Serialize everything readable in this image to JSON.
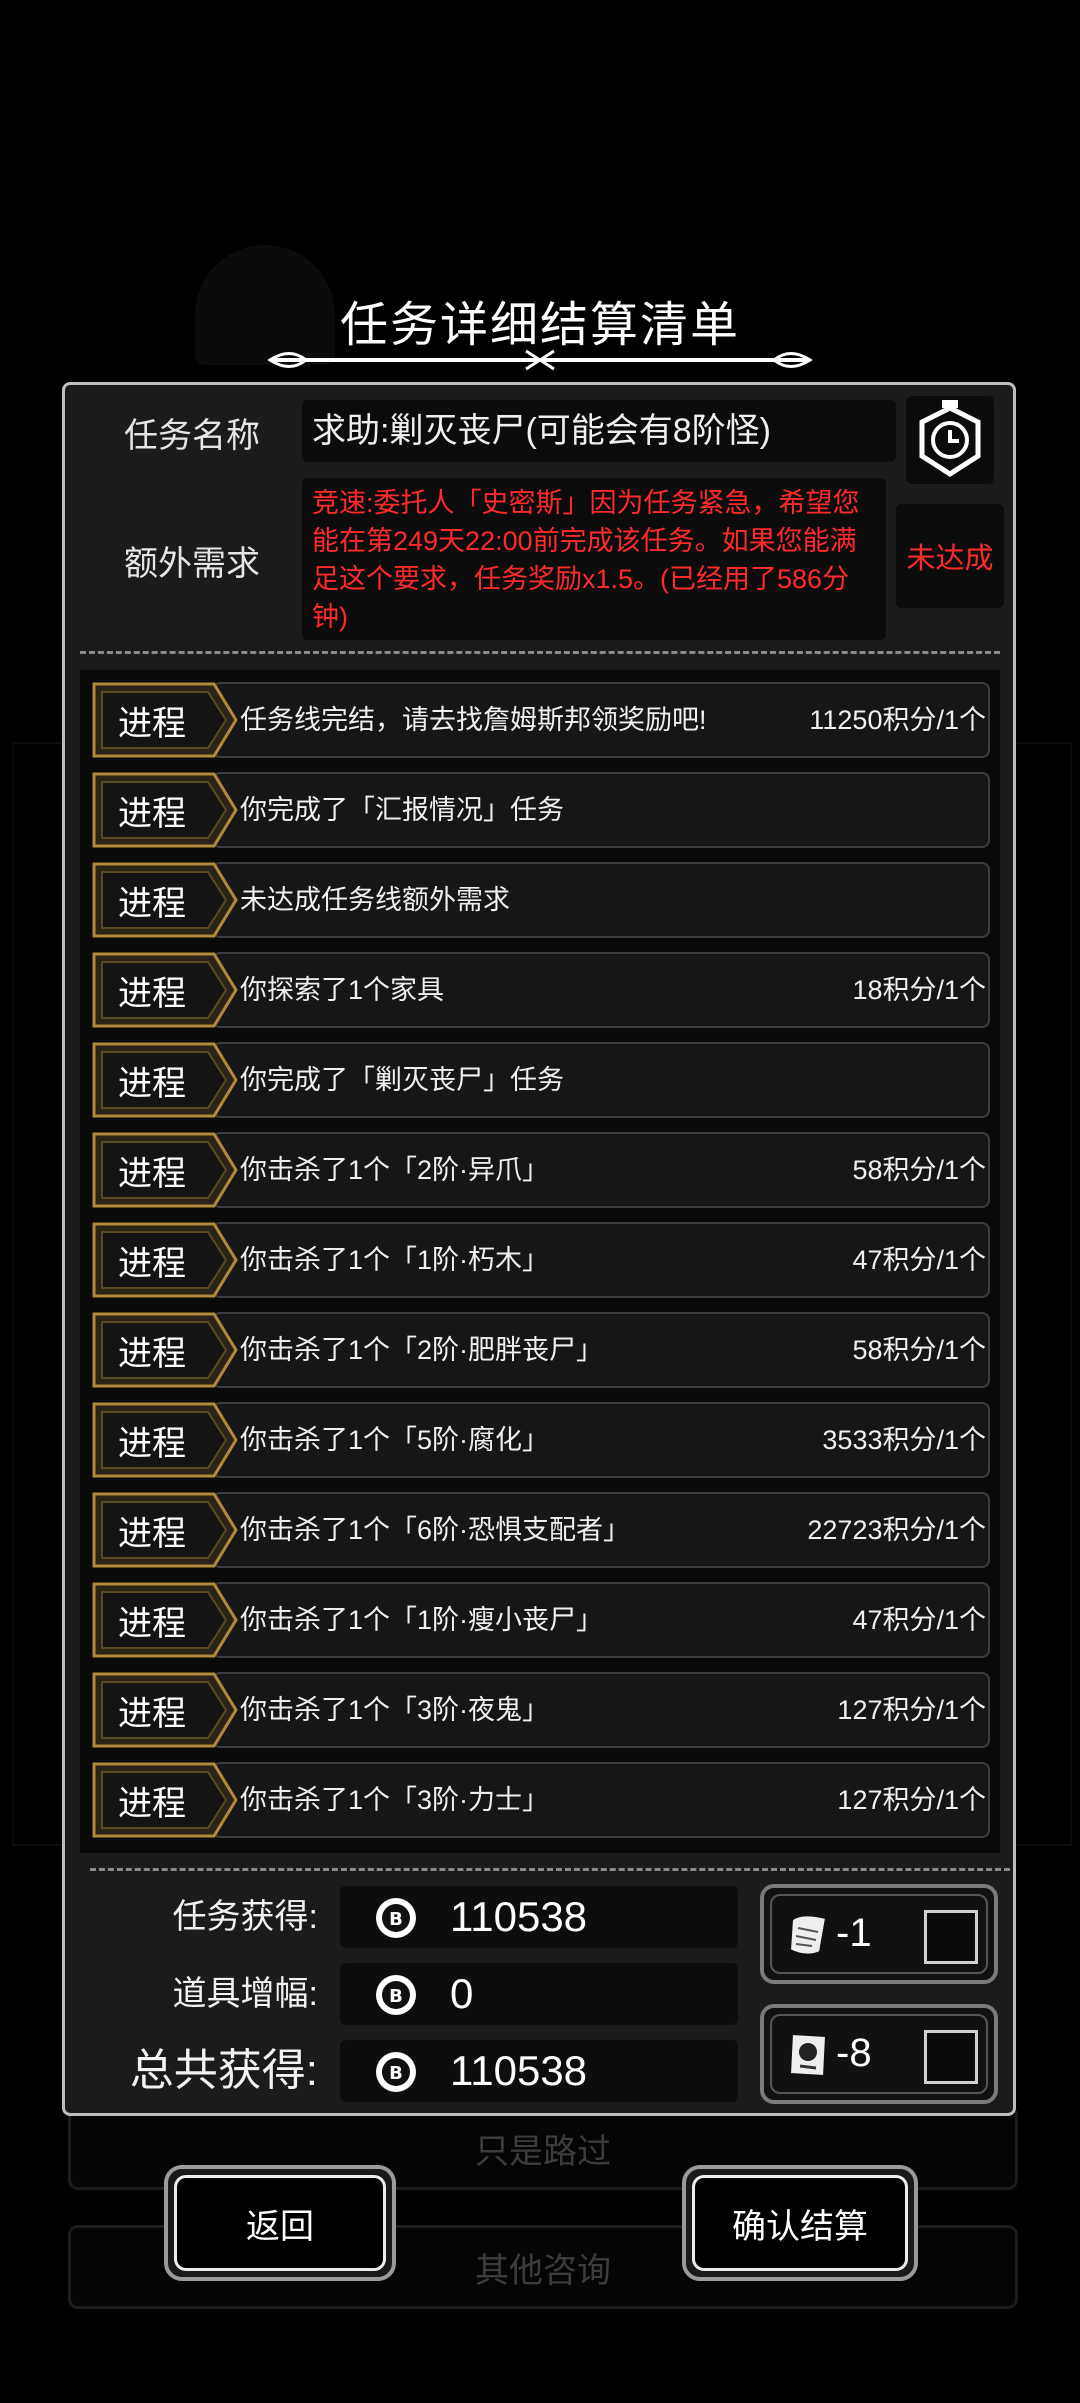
{
  "dialog": {
    "title": "任务详细结算清单"
  },
  "task": {
    "name_label": "任务名称",
    "name_value": "求助:剿灭丧尸(可能会有8阶怪)",
    "extra_label": "额外需求",
    "extra_value": "竞速:委托人「史密斯」因为任务紧急，希望您能在第249天22:00前完成该任务。如果您能满足这个要求，任务奖励x1.5。(已经用了586分钟)",
    "extra_status": "未达成"
  },
  "progress": {
    "tag_label": "进程",
    "rows": [
      {
        "text": "任务线完结，请去找詹姆斯邦领奖励吧!",
        "points": "11250积分/1个"
      },
      {
        "text": "你完成了「汇报情况」任务",
        "points": ""
      },
      {
        "text": "未达成任务线额外需求",
        "points": ""
      },
      {
        "text": "你探索了1个家具",
        "points": "18积分/1个"
      },
      {
        "text": "你完成了「剿灭丧尸」任务",
        "points": ""
      },
      {
        "text": "你击杀了1个「2阶·异爪」",
        "points": "58积分/1个"
      },
      {
        "text": "你击杀了1个「1阶·朽木」",
        "points": "47积分/1个"
      },
      {
        "text": "你击杀了1个「2阶·肥胖丧尸」",
        "points": "58积分/1个"
      },
      {
        "text": "你击杀了1个「5阶·腐化」",
        "points": "3533积分/1个"
      },
      {
        "text": "你击杀了1个「6阶·恐惧支配者」",
        "points": "22723积分/1个"
      },
      {
        "text": "你击杀了1个「1阶·瘦小丧尸」",
        "points": "47积分/1个"
      },
      {
        "text": "你击杀了1个「3阶·夜鬼」",
        "points": "127积分/1个"
      },
      {
        "text": "你击杀了1个「3阶·力士」",
        "points": "127积分/1个"
      }
    ]
  },
  "totals": {
    "task_label": "任务获得:",
    "task_value": "110538",
    "item_label": "道具增幅:",
    "item_value": "0",
    "total_label": "总共获得:",
    "total_value": "110538"
  },
  "items": [
    {
      "icon": "scroll-icon",
      "count": "-1"
    },
    {
      "icon": "card-icon",
      "count": "-8"
    }
  ],
  "buttons": {
    "back": "返回",
    "confirm": "确认结算"
  },
  "background": {
    "option1": "只是路过",
    "option2": "其他咨询"
  },
  "colors": {
    "warning": "#ff2a2a",
    "tag_gold": "#8a6a2a",
    "panel_border": "#bdbdbd"
  }
}
